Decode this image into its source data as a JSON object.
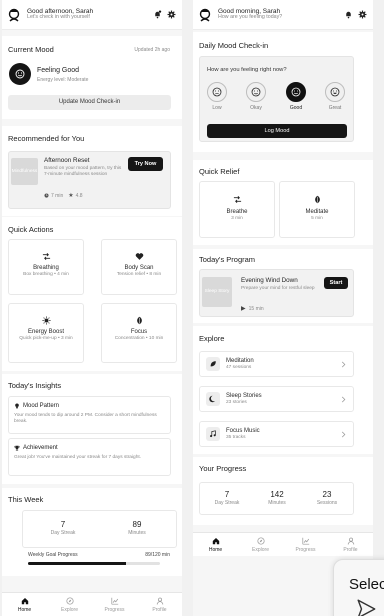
{
  "left": {
    "header": {
      "greeting": "Good afternoon, Sarah",
      "subtitle": "Let's check in with yourself"
    },
    "current_mood": {
      "title": "Current Mood",
      "updated": "Updated 2h ago",
      "mood": "Feeling Good",
      "energy": "Energy level: Moderate",
      "button": "Update Mood Check-in"
    },
    "recommended": {
      "title": "Recommended for You",
      "thumb_label": "Mindfulness",
      "item_title": "Afternoon Reset",
      "item_desc": "Based on your mood pattern, try this 7-minute mindfulness session",
      "duration": "7 min",
      "rating": "4.8",
      "button": "Try Now"
    },
    "quick_actions": {
      "title": "Quick Actions",
      "items": [
        {
          "name": "Breathing",
          "desc": "Box breathing • 4 min",
          "icon": "shuffle-icon"
        },
        {
          "name": "Body Scan",
          "desc": "Tension relief • 8 min",
          "icon": "heart-icon"
        },
        {
          "name": "Energy Boost",
          "desc": "Quick pick-me-up • 3 min",
          "icon": "sun-icon"
        },
        {
          "name": "Focus",
          "desc": "Concentration • 10 min",
          "icon": "leaf-icon"
        }
      ]
    },
    "insights": {
      "title": "Today's Insights",
      "items": [
        {
          "title": "Mood Pattern",
          "text": "Your mood tends to dip around 2 PM. Consider a short mindfulness break."
        },
        {
          "title": "Achievement",
          "text": "Great job! You've maintained your streak for 7 days straight."
        }
      ]
    },
    "this_week": {
      "title": "This Week",
      "streak_value": "7",
      "streak_label": "Day Streak",
      "minutes_value": "89",
      "minutes_label": "Minutes",
      "goal_label": "Weekly Goal Progress",
      "goal_value": "89/120 min",
      "goal_fraction": 0.74
    },
    "nav": [
      "Home",
      "Explore",
      "Progress",
      "Profile"
    ]
  },
  "right": {
    "header": {
      "greeting": "Good morning, Sarah",
      "subtitle": "How are you feeling today?"
    },
    "checkin": {
      "title": "Daily Mood Check-in",
      "question": "How are you feeling right now?",
      "options": [
        "Low",
        "Okay",
        "Good",
        "Great"
      ],
      "selected": "Good",
      "button": "Log Mood"
    },
    "quick_relief": {
      "title": "Quick Relief",
      "items": [
        {
          "name": "Breathe",
          "duration": "3 min"
        },
        {
          "name": "Meditate",
          "duration": "5 min"
        }
      ]
    },
    "program": {
      "title": "Today's Program",
      "thumb_label": "Sleep Story",
      "item_title": "Evening Wind Down",
      "item_desc": "Prepare your mind for restful sleep",
      "duration": "15 min",
      "button": "Start"
    },
    "explore": {
      "title": "Explore",
      "items": [
        {
          "name": "Meditation",
          "sub": "47 sessions",
          "icon": "leaf-icon"
        },
        {
          "name": "Sleep Stories",
          "sub": "23 stories",
          "icon": "moon-icon"
        },
        {
          "name": "Focus Music",
          "sub": "35 tracks",
          "icon": "music-icon"
        }
      ]
    },
    "progress": {
      "title": "Your Progress",
      "stats": [
        {
          "value": "7",
          "label": "Day Streak"
        },
        {
          "value": "142",
          "label": "Minutes"
        },
        {
          "value": "23",
          "label": "Sessions"
        }
      ]
    },
    "nav": [
      "Home",
      "Explore",
      "Progress",
      "Profile"
    ]
  },
  "popup": {
    "text": "Selec"
  },
  "colors": {
    "accent": "#151515",
    "background": "#f6f6f6",
    "card": "#ffffff"
  }
}
